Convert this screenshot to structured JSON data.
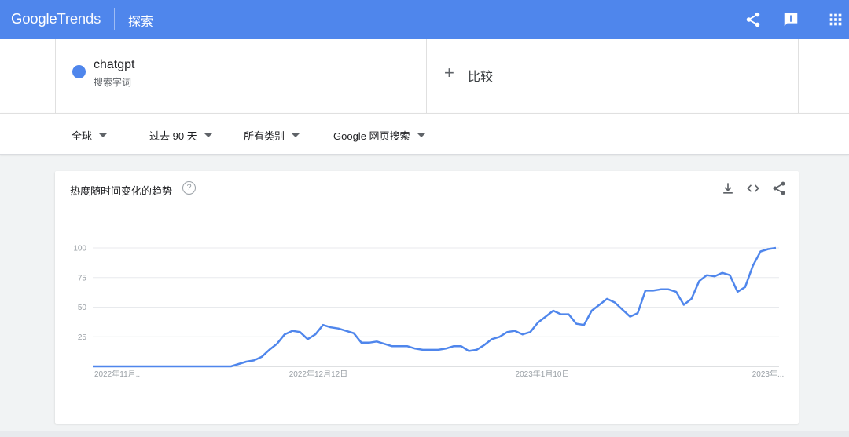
{
  "header": {
    "logo_google": "Google",
    "logo_trends": "Trends",
    "section_title": "探索",
    "icons": [
      "share-icon",
      "feedback-icon",
      "apps-grid-icon"
    ],
    "color": "#4f86ec"
  },
  "search_term": {
    "name": "chatgpt",
    "type": "搜索字词",
    "color": "#4f86ec"
  },
  "compare": {
    "plus": "+",
    "label": "比较"
  },
  "filters": {
    "region": "全球",
    "time_range": "过去 90 天",
    "category": "所有类别",
    "search_type": "Google 网页搜索"
  },
  "interest_card": {
    "title": "热度随时间变化的趋势",
    "help": "?",
    "icons": [
      "download-icon",
      "embed-code-icon",
      "share-icon"
    ]
  },
  "chart_data": {
    "type": "line",
    "ylim": [
      0,
      100
    ],
    "yticks": [
      "25",
      "50",
      "75",
      "100"
    ],
    "x_tick_labels": [
      "2022年11月...",
      "2022年12月12日",
      "2023年1月10日",
      "2023年..."
    ],
    "grid": true,
    "series": [
      {
        "color": "#4f86ec",
        "values": [
          0,
          0,
          0,
          0,
          0,
          0,
          0,
          0,
          0,
          0,
          0,
          0,
          0,
          0,
          0,
          0,
          0,
          0,
          0,
          2,
          4,
          5,
          8,
          14,
          19,
          27,
          30,
          29,
          23,
          27,
          35,
          33,
          32,
          30,
          28,
          20,
          20,
          21,
          19,
          17,
          17,
          17,
          15,
          14,
          14,
          14,
          15,
          17,
          17,
          13,
          14,
          18,
          23,
          25,
          29,
          30,
          27,
          29,
          37,
          42,
          47,
          44,
          44,
          36,
          35,
          47,
          52,
          57,
          54,
          48,
          42,
          45,
          64,
          64,
          65,
          65,
          63,
          52,
          57,
          72,
          77,
          76,
          79,
          77,
          63,
          67,
          85,
          97,
          99,
          100
        ]
      }
    ]
  }
}
